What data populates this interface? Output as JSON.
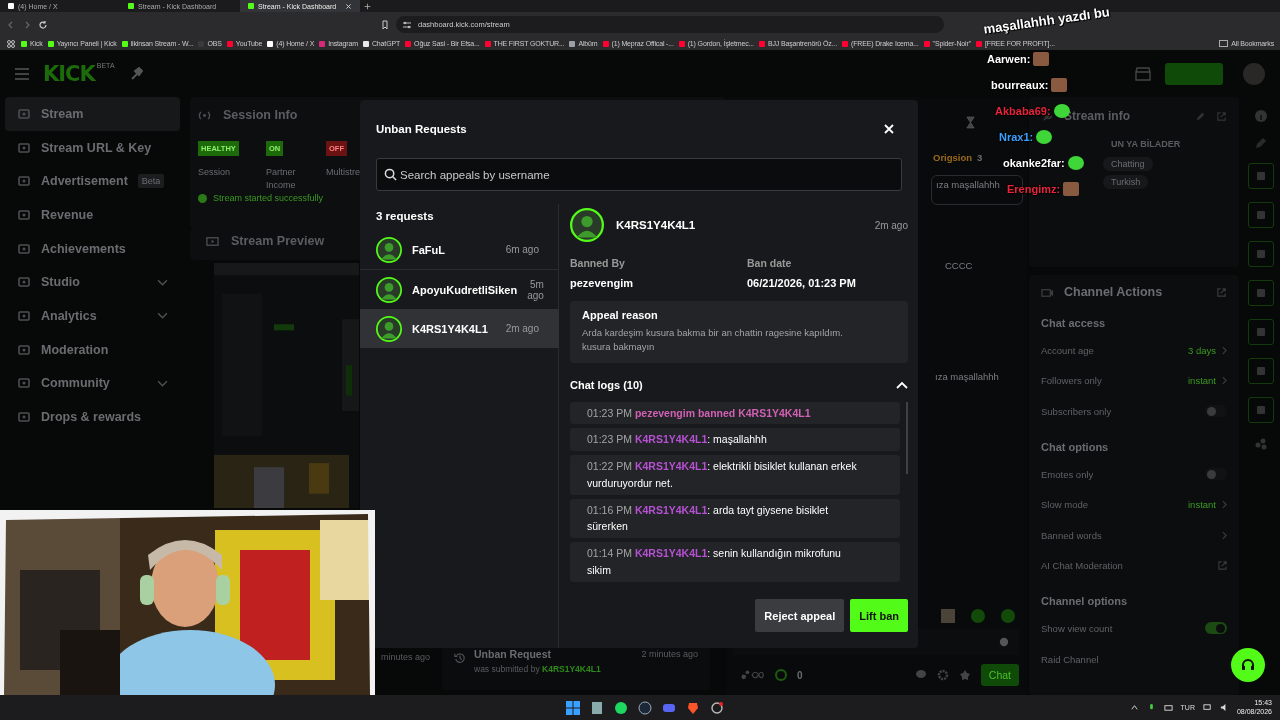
{
  "browser": {
    "tabs": [
      {
        "title": "(4) Home / X",
        "selected": false,
        "color": "#ffffff"
      },
      {
        "title": "Stream - Kick Dashboard",
        "selected": false,
        "color": "#53fc18"
      },
      {
        "title": "Stream - Kick Dashboard",
        "selected": true,
        "color": "#53fc18"
      }
    ],
    "url": "dashboard.kick.com/stream",
    "bookmarks": [
      {
        "label": "Kick",
        "color": "#53fc18"
      },
      {
        "label": "Yayıncı Paneli | Kick",
        "color": "#53fc18"
      },
      {
        "label": "ilkinsan Stream - W...",
        "color": "#53fc18"
      },
      {
        "label": "OBS",
        "color": "#3a3a3a"
      },
      {
        "label": "YouTube",
        "color": "#ff0033"
      },
      {
        "label": "(4) Home / X",
        "color": "#ffffff"
      },
      {
        "label": "Instagram",
        "color": "#d62976"
      },
      {
        "label": "ChatGPT",
        "color": "#e8e8e8"
      },
      {
        "label": "Oğuz Sasi - Bir Efsa...",
        "color": "#ff0033"
      },
      {
        "label": "THE FIRST GOKTUR...",
        "color": "#ff0033"
      },
      {
        "label": "Albüm",
        "color": "#9aa0a6"
      },
      {
        "label": "(1) Mepraz Offical -...",
        "color": "#ff0033"
      },
      {
        "label": "(1) Gordon, İşletmec...",
        "color": "#ff0033"
      },
      {
        "label": "BJJ Başantrenörü Öz...",
        "color": "#ff0033"
      },
      {
        "label": "(FREE) Drake Icema...",
        "color": "#ff0033"
      },
      {
        "label": "\"Spider-Noir\"",
        "color": "#ff0033"
      },
      {
        "label": "[FREE FOR PROFIT]...",
        "color": "#ff0033"
      }
    ],
    "all_bookmarks": "All Bookmarks"
  },
  "dashboard": {
    "logo": "KICK",
    "logo_badge": "BETA",
    "sidebar": [
      {
        "label": "Stream",
        "selected": true
      },
      {
        "label": "Stream URL & Key",
        "selected": false
      },
      {
        "label": "Advertisement",
        "selected": false,
        "badge": "Beta"
      },
      {
        "label": "Revenue",
        "selected": false
      },
      {
        "label": "Achievements",
        "selected": false
      },
      {
        "label": "Studio",
        "selected": false,
        "expandable": true
      },
      {
        "label": "Analytics",
        "selected": false,
        "expandable": true
      },
      {
        "label": "Moderation",
        "selected": false
      },
      {
        "label": "Community",
        "selected": false,
        "expandable": true
      },
      {
        "label": "Drops & rewards",
        "selected": false
      }
    ],
    "session_info": {
      "title": "Session Info",
      "stats": [
        {
          "value": "HEALTHY",
          "label": "Session",
          "color": "#1d6a0b"
        },
        {
          "value": "ON",
          "label": "Partner Income",
          "color": "#1d6a0b"
        },
        {
          "value": "OFF",
          "label": "Multistre",
          "color": "#6b1212"
        }
      ],
      "notice": "Stream started successfully"
    },
    "stream_preview": {
      "title": "Stream Preview"
    },
    "activity": [
      {
        "time": "minutes ago"
      },
      {
        "title": "Unban Request",
        "time": "2 minutes ago",
        "text": "was submitted by ",
        "user": "K4RS1Y4K4L1"
      }
    ],
    "chat": {
      "top_user": "Origsion",
      "top_count": "3",
      "messages": [
        "ıza maşallahhh",
        "CCCC",
        "ıza maşallahhh"
      ],
      "viewers": "0",
      "send": "Chat"
    },
    "stream_info": {
      "title": "Stream info",
      "stream_title": "UN YA BİLADER",
      "tags": [
        "Chatting",
        "Turkish"
      ]
    },
    "channel_actions": {
      "title": "Channel Actions",
      "sections": [
        {
          "title": "Chat access",
          "rows": [
            {
              "kind": "link",
              "label": "Account age",
              "value": "3 days"
            },
            {
              "kind": "link",
              "label": "Followers only",
              "value": "instant"
            },
            {
              "kind": "toggle",
              "label": "Subscribers only",
              "on": false
            }
          ]
        },
        {
          "title": "Chat options",
          "rows": [
            {
              "kind": "toggle",
              "label": "Emotes only",
              "on": false
            },
            {
              "kind": "link",
              "label": "Slow mode",
              "value": "instant"
            },
            {
              "kind": "link",
              "label": "Banned words"
            },
            {
              "kind": "external",
              "label": "AI Chat Moderation"
            }
          ]
        },
        {
          "title": "Channel options",
          "rows": [
            {
              "kind": "toggle",
              "label": "Show view count",
              "on": true
            },
            {
              "kind": "plain",
              "label": "Raid Channel"
            }
          ]
        }
      ]
    }
  },
  "modal": {
    "title": "Unban Requests",
    "search_placeholder": "Search appeals by username",
    "count": "3 requests",
    "requests": [
      {
        "name": "FaFuL",
        "time": "6m ago",
        "selected": false
      },
      {
        "name": "ApoyuKudretliSiken",
        "time": "5m ago",
        "selected": false
      },
      {
        "name": "K4RS1Y4K4L1",
        "time": "2m ago",
        "selected": true
      }
    ],
    "detail": {
      "name": "K4RS1Y4K4L1",
      "time": "2m ago",
      "banned_by_label": "Banned By",
      "banned_by": "pezevengim",
      "ban_date_label": "Ban date",
      "ban_date": "06/21/2026, 01:23 PM",
      "appeal_title": "Appeal reason",
      "appeal_text": "Arda kardeşim kusura bakma bir an chattin ragesine kapıldım. kusura bakmayın",
      "logs_title": "Chat logs (10)",
      "logs_expanded": true,
      "logs": [
        {
          "kind": "system",
          "time": "01:23 PM",
          "text": "pezevengim banned K4RS1Y4K4L1"
        },
        {
          "kind": "message",
          "time": "01:23 PM",
          "user": "K4RS1Y4K4L1",
          "text": ": maşallahhh"
        },
        {
          "kind": "message",
          "time": "01:22 PM",
          "user": "K4RS1Y4K4L1",
          "text": ": elektrikli bisiklet kullanan erkek vurduruyordur net."
        },
        {
          "kind": "message",
          "time": "01:16 PM",
          "user": "K4RS1Y4K4L1",
          "text": ": arda tayt giysene bisiklet sürerken"
        },
        {
          "kind": "message",
          "time": "01:14 PM",
          "user": "K4RS1Y4K4L1",
          "text": ": senin kullandığın mikrofunu sikim"
        }
      ]
    },
    "reject": "Reject appeal",
    "lift": "Lift ban"
  },
  "overlay_chat": [
    {
      "text": "maşallahhh yazdı bu",
      "color": "#ffffff"
    },
    {
      "text": "Aarwen:",
      "color": "#ffffff"
    },
    {
      "text": "bourreaux:",
      "color": "#ffffff"
    },
    {
      "text": "Akbaba69:",
      "color": "#e8243c"
    },
    {
      "text": "Nrax1:",
      "color": "#3aa0ff"
    },
    {
      "text": "okanke2far:",
      "color": "#ffffff"
    },
    {
      "text": "Erengimz:",
      "color": "#e8243c"
    }
  ],
  "taskbar": {
    "language": "TUR",
    "time": "15:43",
    "date": "08/08/2026"
  }
}
